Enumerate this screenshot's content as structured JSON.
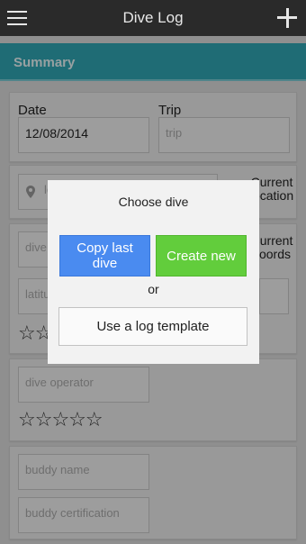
{
  "app_bar": {
    "title": "Dive Log",
    "menu_icon": "menu-icon",
    "add_icon": "plus-icon"
  },
  "summary": {
    "label": "Summary"
  },
  "date_trip": {
    "date_label": "Date",
    "date_value": "12/08/2014",
    "trip_label": "Trip",
    "trip_placeholder": "trip"
  },
  "location": {
    "placeholder": "lo",
    "current_location_line1": "Current",
    "current_location_line2": "location"
  },
  "dive_site": {
    "dive_placeholder": "dive",
    "latitude_placeholder": "latitu",
    "current_coords_line1": "Current",
    "current_coords_line2": "coords",
    "rating_stars": "☆☆"
  },
  "operator": {
    "placeholder": "dive operator",
    "rating_stars": "☆☆☆☆☆"
  },
  "buddy": {
    "name_placeholder": "buddy name",
    "certification_placeholder": "buddy certification"
  },
  "dialog": {
    "title": "Choose dive",
    "copy_last_line1": "Copy last",
    "copy_last_line2": "dive",
    "create_new": "Create new",
    "or": "or",
    "use_template": "Use a log template"
  },
  "colors": {
    "app_bar": "#2a2a2a",
    "summary": "#30a6b4",
    "copy_button": "#4a8bf0",
    "create_button": "#62cd3c"
  }
}
